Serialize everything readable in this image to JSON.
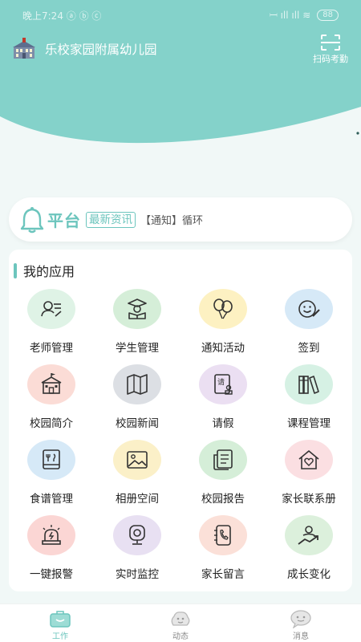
{
  "status_bar": {
    "time": "晚上7:24 ⓐ ⓑ ⓒ",
    "signal": "𝄩 ıll ıll ≋",
    "battery": "88"
  },
  "header": {
    "title": "乐校家园附属幼儿园",
    "scan_label": "扫码考勤"
  },
  "notice": {
    "brand": "平台",
    "tag": "最新资讯",
    "text": "【通知】循环"
  },
  "apps": {
    "section_title": "我的应用",
    "items": [
      {
        "label": "老师管理",
        "icon": "teacher-icon",
        "bg": "#dff3e6"
      },
      {
        "label": "学生管理",
        "icon": "student-icon",
        "bg": "#d5eed8"
      },
      {
        "label": "通知活动",
        "icon": "balloon-icon",
        "bg": "#fdf1c2"
      },
      {
        "label": "签到",
        "icon": "smiley-pen-icon",
        "bg": "#d6e9f7"
      },
      {
        "label": "校园简介",
        "icon": "school-icon",
        "bg": "#fbdcd6"
      },
      {
        "label": "校园新闻",
        "icon": "map-icon",
        "bg": "#dcdfe4"
      },
      {
        "label": "请假",
        "icon": "leave-stamp-icon",
        "bg": "#ebdff2"
      },
      {
        "label": "课程管理",
        "icon": "books-icon",
        "bg": "#d6f1e4"
      },
      {
        "label": "食谱管理",
        "icon": "recipe-icon",
        "bg": "#d6e9f7"
      },
      {
        "label": "相册空间",
        "icon": "photo-icon",
        "bg": "#fbf0c8"
      },
      {
        "label": "校园报告",
        "icon": "report-icon",
        "bg": "#d5eed8"
      },
      {
        "label": "家长联系册",
        "icon": "home-heart-icon",
        "bg": "#fbdfe2"
      },
      {
        "label": "一键报警",
        "icon": "alarm-icon",
        "bg": "#fbd6d4"
      },
      {
        "label": "实时监控",
        "icon": "camera-icon",
        "bg": "#e8e0f2"
      },
      {
        "label": "家长留言",
        "icon": "phone-book-icon",
        "bg": "#fbe0d8"
      },
      {
        "label": "成长变化",
        "icon": "growth-icon",
        "bg": "#dcf0dc"
      }
    ]
  },
  "nav": {
    "items": [
      {
        "label": "工作",
        "icon": "work-icon",
        "active": true
      },
      {
        "label": "动态",
        "icon": "moments-icon",
        "active": false
      },
      {
        "label": "消息",
        "icon": "message-icon",
        "active": false
      }
    ]
  },
  "colors": {
    "accent": "#6cc5bd",
    "header_bg": "#84d2ca",
    "page_bg": "#f1f8f7"
  }
}
